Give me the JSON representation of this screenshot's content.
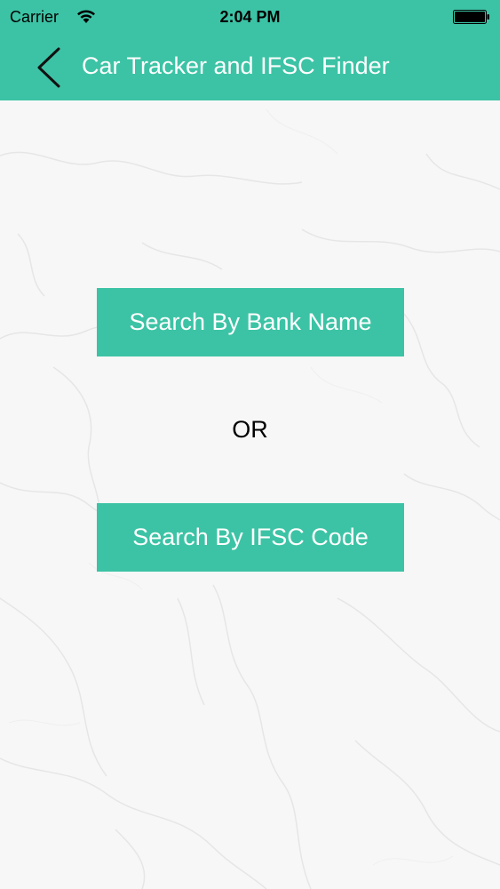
{
  "status_bar": {
    "carrier": "Carrier",
    "time": "2:04 PM",
    "wifi_icon": "wifi-icon",
    "battery_icon": "battery-icon"
  },
  "nav": {
    "back_icon": "chevron-left-icon",
    "title": "Car Tracker and IFSC Finder"
  },
  "main": {
    "bank_button_label": "Search By Bank Name",
    "separator": "OR",
    "ifsc_button_label": "Search By IFSC Code"
  },
  "colors": {
    "accent": "#3cc3a5",
    "background": "#f7f7f7"
  }
}
